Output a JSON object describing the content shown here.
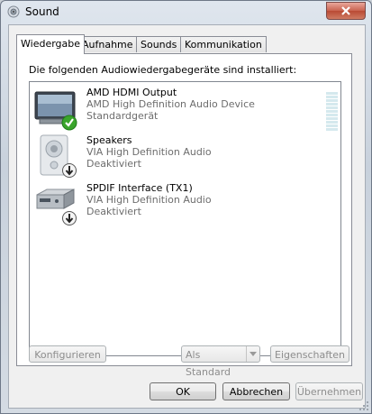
{
  "window": {
    "title": "Sound"
  },
  "tabs": [
    "Wiedergabe",
    "Aufnahme",
    "Sounds",
    "Kommunikation"
  ],
  "panel": {
    "caption": "Die folgenden Audiowiedergabegeräte sind installiert:"
  },
  "devices": [
    {
      "name": "AMD HDMI Output",
      "description": "AMD High Definition Audio Device",
      "status": "Standardgerät",
      "icon": "monitor-icon",
      "badge": "default-checkmark-icon"
    },
    {
      "name": "Speakers",
      "description": "VIA High Definition Audio",
      "status": "Deaktiviert",
      "icon": "speaker-icon",
      "badge": "disabled-arrow-icon"
    },
    {
      "name": "SPDIF Interface (TX1)",
      "description": "VIA High Definition Audio",
      "status": "Deaktiviert",
      "icon": "spdif-device-icon",
      "badge": "disabled-arrow-icon"
    }
  ],
  "buttons": {
    "configure": "Konfigurieren",
    "set_default": "Als Standard",
    "properties": "Eigenschaften",
    "ok": "OK",
    "cancel": "Abbrechen",
    "apply": "Übernehmen"
  },
  "colors": {
    "accent_check": "#3aa52c",
    "disabled_text": "#8d8d8d",
    "secondary_text": "#6d6d6d"
  }
}
